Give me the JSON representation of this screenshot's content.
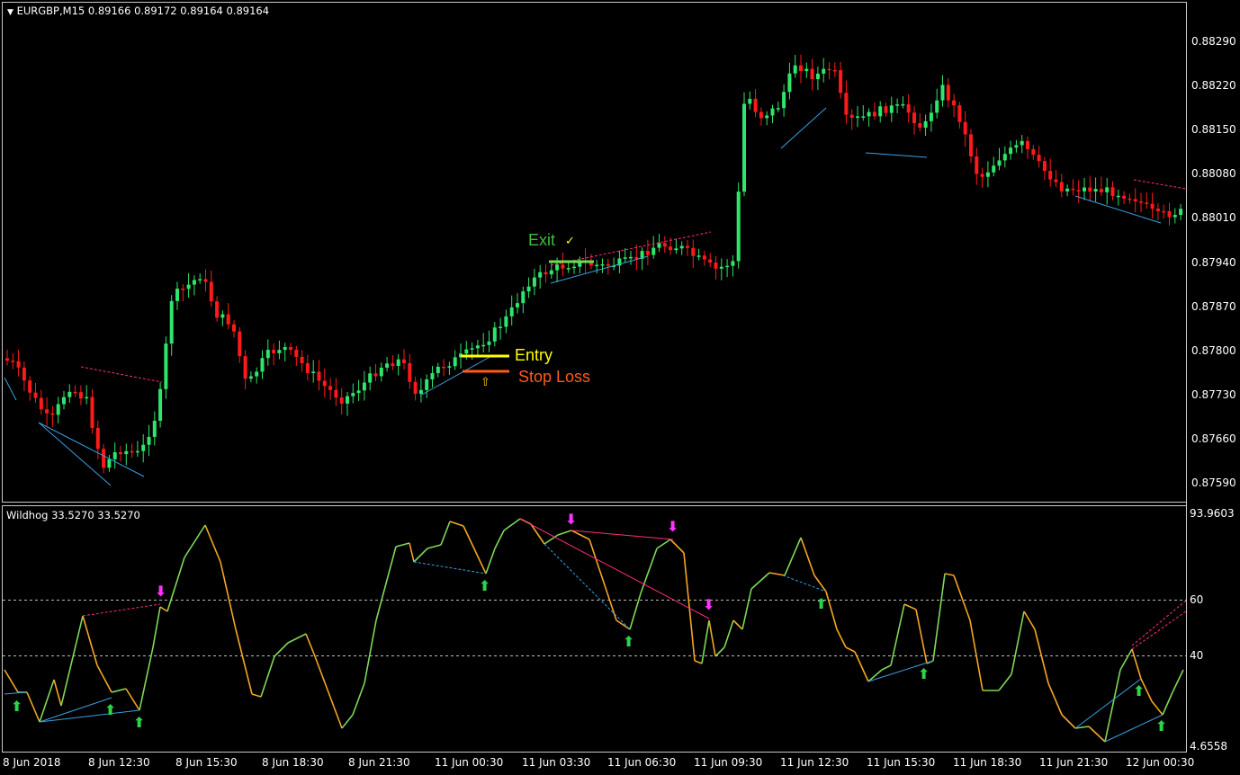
{
  "main_chart": {
    "title": "EURGBP,M15  0.89166 0.89172 0.89164 0.89164",
    "price_labels": [
      "0.88290",
      "0.88220",
      "0.88150",
      "0.88080",
      "0.88010",
      "0.87940",
      "0.87870",
      "0.87800",
      "0.87730",
      "0.87660",
      "0.87590"
    ],
    "annotations": {
      "exit": "Exit",
      "check": "✓",
      "entry": "Entry",
      "stop_loss": "Stop Loss",
      "outline_up_arrow": "⇧"
    }
  },
  "indicator": {
    "title": "Wildhog 33.5270 33.5270",
    "scale_labels": [
      "93.9603",
      "60",
      "40",
      "4.6558"
    ]
  },
  "time_axis": [
    "8 Jun 2018",
    "8 Jun 12:30",
    "8 Jun 15:30",
    "8 Jun 18:30",
    "8 Jun 21:30",
    "11 Jun 00:30",
    "11 Jun 03:30",
    "11 Jun 06:30",
    "11 Jun 09:30",
    "11 Jun 12:30",
    "11 Jun 15:30",
    "11 Jun 18:30",
    "11 Jun 21:30",
    "12 Jun 00:30"
  ],
  "colors": {
    "background": "#000000",
    "bull_candle": "#2ee66b",
    "bear_candle": "#ff1a1a",
    "osc_up": "#7ed957",
    "osc_down": "#f5a623",
    "divergence_blue": "#3aa0e0",
    "divergence_pink": "#ff2d7a",
    "entry_line": "#ffff00",
    "stop_line": "#ff5a1a",
    "exit_text": "#3dc03d",
    "arrow_up": "#2bd44a",
    "arrow_down": "#ff33ff",
    "grid_text": "#ffffff"
  },
  "signals": {
    "up_arrow": "⬆",
    "down_arrow": "⬇"
  }
}
